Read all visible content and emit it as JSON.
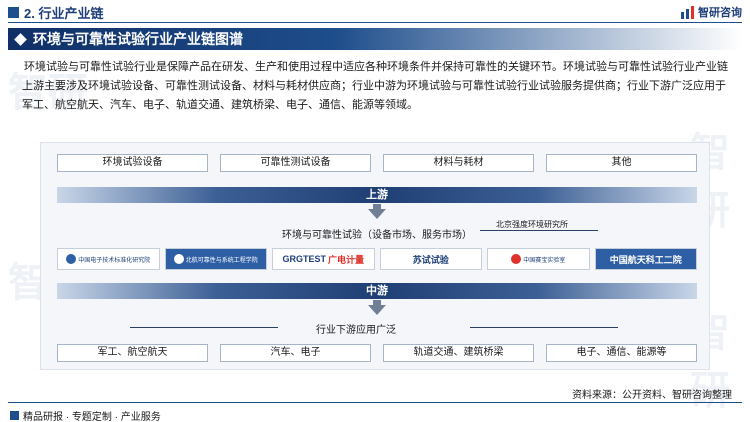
{
  "header": {
    "section": "2. 行业产业链",
    "logo_text": "智研咨询"
  },
  "title": "环境与可靠性试验行业产业链图谱",
  "intro": "环境试验与可靠性试验行业是保障产品在研发、生产和使用过程中适应各种环境条件并保持可靠性的关键环节。环境试验与可靠性试验行业产业链上游主要涉及环境试验设备、可靠性测试设备、材料与耗材供应商；行业中游为环境试验与可靠性试验行业试验服务提供商；行业下游广泛应用于军工、航空航天、汽车、电子、轨道交通、建筑桥梁、电子、通信、能源等领域。",
  "upstream": {
    "items": [
      "环境试验设备",
      "可靠性测试设备",
      "材料与耗材",
      "其他"
    ],
    "band": "上游"
  },
  "midstream": {
    "label": "环境与可靠性试验（设备市场、服务市场）",
    "company_label": "北京强度环境研究所",
    "logos": [
      {
        "name": "中国电子技术标准化研究院",
        "sub": "China Electronics Standardization Institute",
        "style": "light"
      },
      {
        "name": "北航可靠性与系统工程学院",
        "sub": "北航可靠性工程研究所",
        "style": "dark"
      },
      {
        "name": "GRGTEST",
        "sub": "广电计量",
        "style": "light"
      },
      {
        "name": "苏试试验",
        "sub": "300416",
        "style": "light"
      },
      {
        "name": "中国赛宝实验室",
        "sub": "工业和信息化部电子第五研究所",
        "style": "light"
      },
      {
        "name": "中国航天科工二院",
        "sub": "",
        "style": "dark"
      }
    ],
    "band": "中游"
  },
  "downstream": {
    "label": "行业下游应用广泛",
    "items": [
      "军工、航空航天",
      "汽车、电子",
      "轨道交通、建筑桥梁",
      "电子、通信、能源等"
    ]
  },
  "source": "资料来源：公开资料、智研咨询整理",
  "footer": {
    "left": "精品研报 · 专题定制 · 产业服务"
  },
  "watermark": "智研"
}
